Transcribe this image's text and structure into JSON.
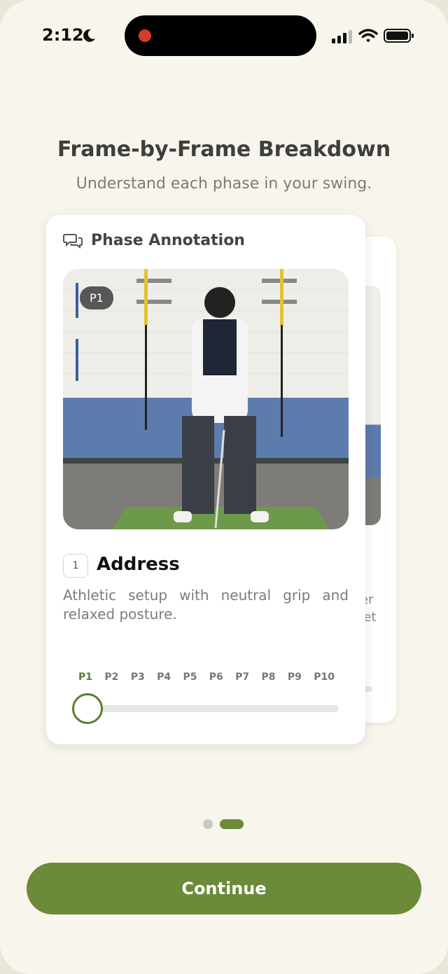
{
  "status_bar": {
    "time": "2:12"
  },
  "header": {
    "title": "Frame-by-Frame Breakdown",
    "subtitle": "Understand each phase in your swing."
  },
  "card": {
    "section_label": "Phase Annotation",
    "photo_badge": "P1",
    "step_number": "1",
    "phase_name": "Address",
    "description": "Athletic setup with neutral grip and relaxed posture.",
    "phases": [
      "P1",
      "P2",
      "P3",
      "P4",
      "P5",
      "P6",
      "P7",
      "P8",
      "P9",
      "P10"
    ],
    "active_phase_index": 0
  },
  "back_card": {
    "peek_lines": [
      "ter",
      "get"
    ]
  },
  "pagination": {
    "count": 2,
    "active": 1
  },
  "footer": {
    "continue_label": "Continue"
  },
  "colors": {
    "accent": "#6b8a3a",
    "background": "#f8f6ec"
  }
}
